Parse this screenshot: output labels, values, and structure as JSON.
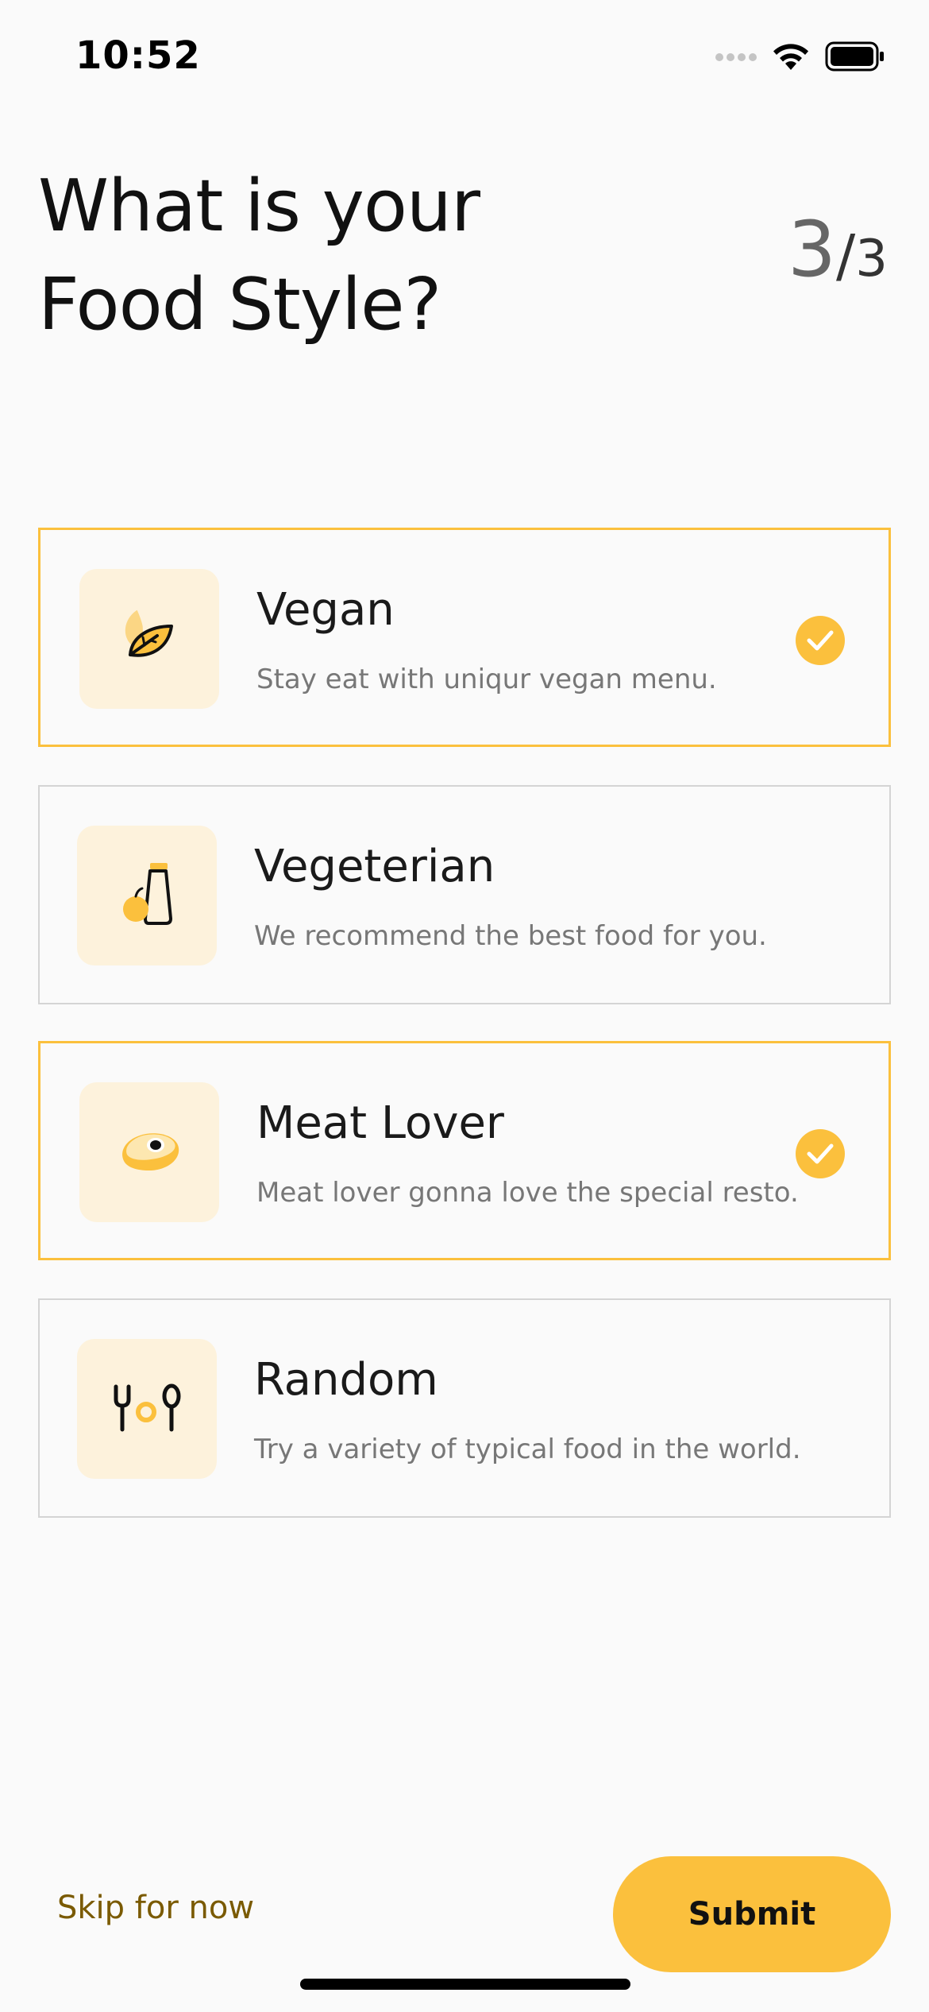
{
  "status_bar": {
    "time": "10:52",
    "signal_icon": "signal-dots-icon",
    "wifi_icon": "wifi-icon",
    "battery_icon": "battery-icon"
  },
  "header": {
    "title_line1": "What is your",
    "title_line2": "Food Style?",
    "step_current": "3",
    "step_separator": "/",
    "step_total": "3"
  },
  "options": [
    {
      "title": "Vegan",
      "description": "Stay eat with uniqur vegan menu.",
      "icon": "leaf-icon",
      "selected": true
    },
    {
      "title": "Vegeterian",
      "description": "We recommend the best food for you.",
      "icon": "bottle-fruit-icon",
      "selected": false
    },
    {
      "title": "Meat Lover",
      "description": "Meat lover gonna love the special resto.",
      "icon": "steak-icon",
      "selected": true
    },
    {
      "title": "Random",
      "description": "Try a variety of typical food in the world.",
      "icon": "utensils-icon",
      "selected": false
    }
  ],
  "footer": {
    "skip_label": "Skip for now",
    "submit_label": "Submit"
  },
  "colors": {
    "accent": "#fbc03d",
    "icon_bg": "#fdf2dc",
    "skip_text": "#7a5a00"
  }
}
